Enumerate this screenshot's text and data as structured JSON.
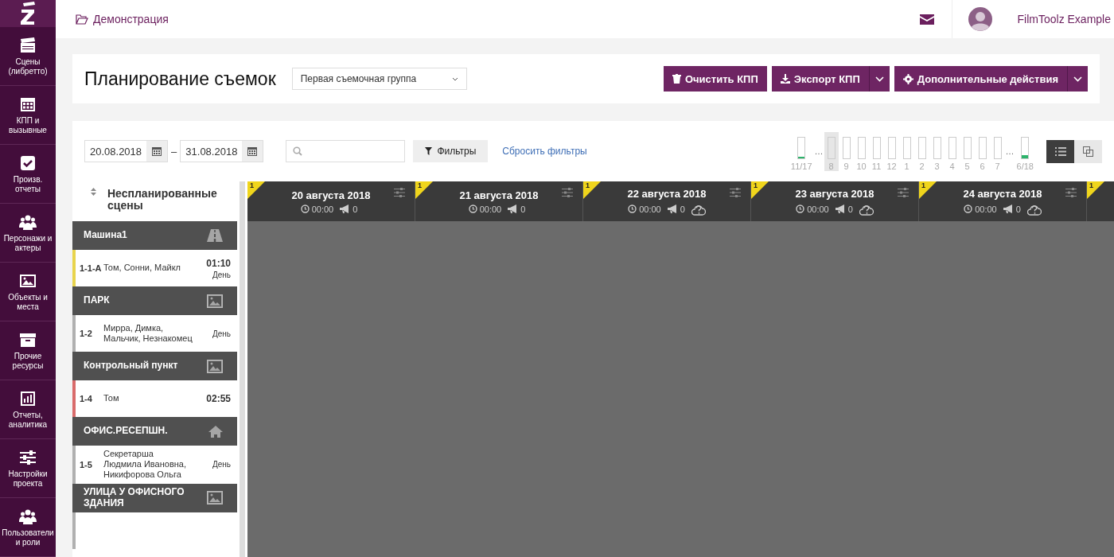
{
  "breadcrumb": "Демонстрация",
  "user": {
    "name": "FilmToolz Example"
  },
  "sidebar": {
    "items": [
      {
        "label": "Сцены (либретто)"
      },
      {
        "label": "КПП и вызывные"
      },
      {
        "label": "Произв. отчеты"
      },
      {
        "label": "Персонажи и актеры"
      },
      {
        "label": "Объекты и места"
      },
      {
        "label": "Прочие ресурсы"
      },
      {
        "label": "Отчеты, аналитика"
      },
      {
        "label": "Настройки проекта"
      },
      {
        "label": "Пользователи и роли"
      }
    ]
  },
  "header": {
    "title": "Планирование съемок",
    "group_select": "Первая съемочная группа",
    "buttons": [
      {
        "label": "Очистить КПП",
        "dropdown": false
      },
      {
        "label": "Экспорт КПП",
        "dropdown": true
      },
      {
        "label": "Дополнительные действия",
        "dropdown": true
      }
    ]
  },
  "toolbar": {
    "date_from": "20.08.2018",
    "date_separator": "–",
    "date_to": "31.08.2018",
    "filters_button": "Фильтры",
    "reset_link": "Сбросить фильтры",
    "months": [
      {
        "kind": "bar",
        "label": "11/17",
        "level": 0.05,
        "selected": false
      },
      {
        "kind": "gap",
        "label": "…"
      },
      {
        "kind": "bar",
        "label": "8",
        "selected": true
      },
      {
        "kind": "bar",
        "label": "9",
        "selected": false
      },
      {
        "kind": "bar",
        "label": "10",
        "selected": false
      },
      {
        "kind": "bar",
        "label": "11",
        "selected": false
      },
      {
        "kind": "bar",
        "label": "12",
        "selected": false
      },
      {
        "kind": "bar",
        "label": "1",
        "selected": false
      },
      {
        "kind": "bar",
        "label": "2",
        "selected": false
      },
      {
        "kind": "bar",
        "label": "3",
        "selected": false
      },
      {
        "kind": "bar",
        "label": "4",
        "selected": false
      },
      {
        "kind": "bar",
        "label": "5",
        "selected": false
      },
      {
        "kind": "bar",
        "label": "6",
        "selected": false
      },
      {
        "kind": "bar",
        "label": "7",
        "selected": false
      },
      {
        "kind": "gap",
        "label": "…"
      },
      {
        "kind": "bar",
        "label": "6/18",
        "level": 0.12,
        "selected": false
      }
    ],
    "views": [
      {
        "selected": true
      },
      {
        "selected": false
      }
    ]
  },
  "unplanned": {
    "title": "Неспланированные сцены",
    "groups": [
      {
        "name": "Машина1",
        "scenes": [
          {
            "number": "1-1-А",
            "cast": "Том, Сонни, Майкл",
            "time": "01:10",
            "daytime": "День",
            "color": "#e8d44d"
          }
        ]
      },
      {
        "name": "ПАРК",
        "scenes": [
          {
            "number": "1-2",
            "cast": "Мирра, Димка, Мальчик, Незнакомец",
            "daytime": "День",
            "color": "#b0b0b0"
          }
        ]
      },
      {
        "name": "Контрольный пункт",
        "scenes": [
          {
            "number": "1-4",
            "cast": "Том",
            "time": "02:55",
            "color": "#d96b6b"
          }
        ]
      },
      {
        "name": "ОФИС.РЕСЕПШН.",
        "scenes": [
          {
            "number": "1-5",
            "cast": "Секретарша Людмила Ивановна, Никифорова Ольга",
            "daytime": "День",
            "color": "#b0b0b0"
          }
        ]
      },
      {
        "name": "УЛИЦА У ОФИСНОГО ЗДАНИЯ",
        "scenes": [
          {
            "color": "#b0b0b0"
          }
        ]
      }
    ]
  },
  "days": [
    {
      "badge": "1",
      "title": "20 августа 2018",
      "time": "00:00",
      "calls": "0",
      "weather": false
    },
    {
      "badge": "1",
      "title": "21 августа 2018",
      "time": "00:00",
      "calls": "0",
      "weather": false
    },
    {
      "badge": "1",
      "title": "22 августа 2018",
      "time": "00:00",
      "calls": "0",
      "weather": true
    },
    {
      "badge": "1",
      "title": "23 августа 2018",
      "time": "00:00",
      "calls": "0",
      "weather": true
    },
    {
      "badge": "1",
      "title": "24 августа 2018",
      "time": "00:00",
      "calls": "0",
      "weather": true
    },
    {
      "badge": "1"
    }
  ]
}
